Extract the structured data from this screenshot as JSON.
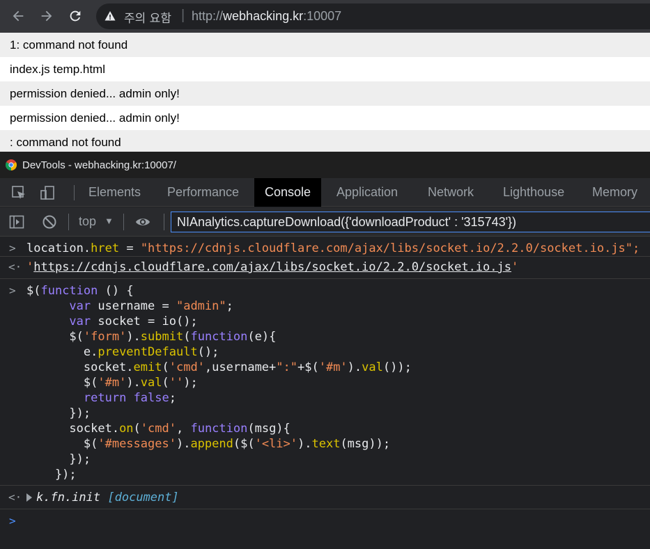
{
  "browser": {
    "security_label": "주의 요함",
    "separator": "|",
    "url_scheme": "http://",
    "url_host": "webhacking.kr",
    "url_port": ":10007"
  },
  "page": {
    "messages": [
      "1: command not found",
      "index.js temp.html",
      "permission denied... admin only!",
      "permission denied... admin only!",
      ": command not found"
    ]
  },
  "devtools": {
    "window_title": "DevTools - webhacking.kr:10007/",
    "tabs": [
      "Elements",
      "Performance",
      "Console",
      "Application",
      "Network",
      "Lighthouse",
      "Memory"
    ],
    "active_tab": "Console",
    "context": "top",
    "filter_value": "NIAnalytics.captureDownload({'downloadProduct' : '315743'})"
  },
  "console": {
    "input1": {
      "obj": "location",
      "prop": "hret",
      "op": " = ",
      "value": "\"https://cdnjs.cloudflare.com/ajax/libs/socket.io/2.2.0/socket.io.js\";"
    },
    "result1": {
      "quote_open": "'",
      "url": "https://cdnjs.cloudflare.com/ajax/libs/socket.io/2.2.0/socket.io.js",
      "quote_close": "'"
    },
    "result2": {
      "func": "k.fn.init",
      "arg": "[document]"
    }
  },
  "colors": {
    "accent": "#4d90fe",
    "keyword": "#9980ff",
    "string": "#f28b54",
    "function": "#dbc300"
  }
}
